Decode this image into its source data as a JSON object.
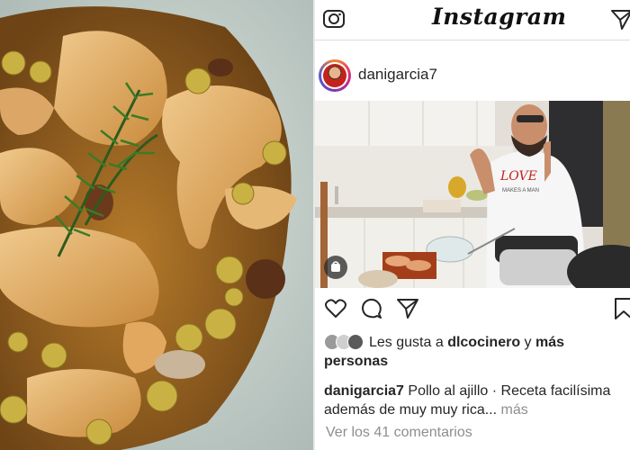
{
  "app": {
    "title": "Instagram"
  },
  "post": {
    "username": "danigarcia7",
    "likes": {
      "prefix": "Les gusta a",
      "user": "dlcocinero",
      "joiner": "y",
      "rest": "más personas"
    },
    "caption": {
      "user": "danigarcia7",
      "text": "Pollo al ajillo · Receta facilísima además de muy muy rica...",
      "more": "más"
    },
    "comments_link": "Ver los 41 comentarios",
    "shirt_text_1": "LOVE",
    "shirt_text_2": "MAKES A MAN"
  },
  "icons": {
    "camera": "camera-icon",
    "direct": "direct-message-icon",
    "like": "heart-icon",
    "comment": "comment-icon",
    "share": "share-icon",
    "save": "bookmark-icon",
    "video_badge": "video-icon"
  },
  "colors": {
    "text": "#262626",
    "muted": "#8e8e8e",
    "border": "#dbdbdb"
  }
}
